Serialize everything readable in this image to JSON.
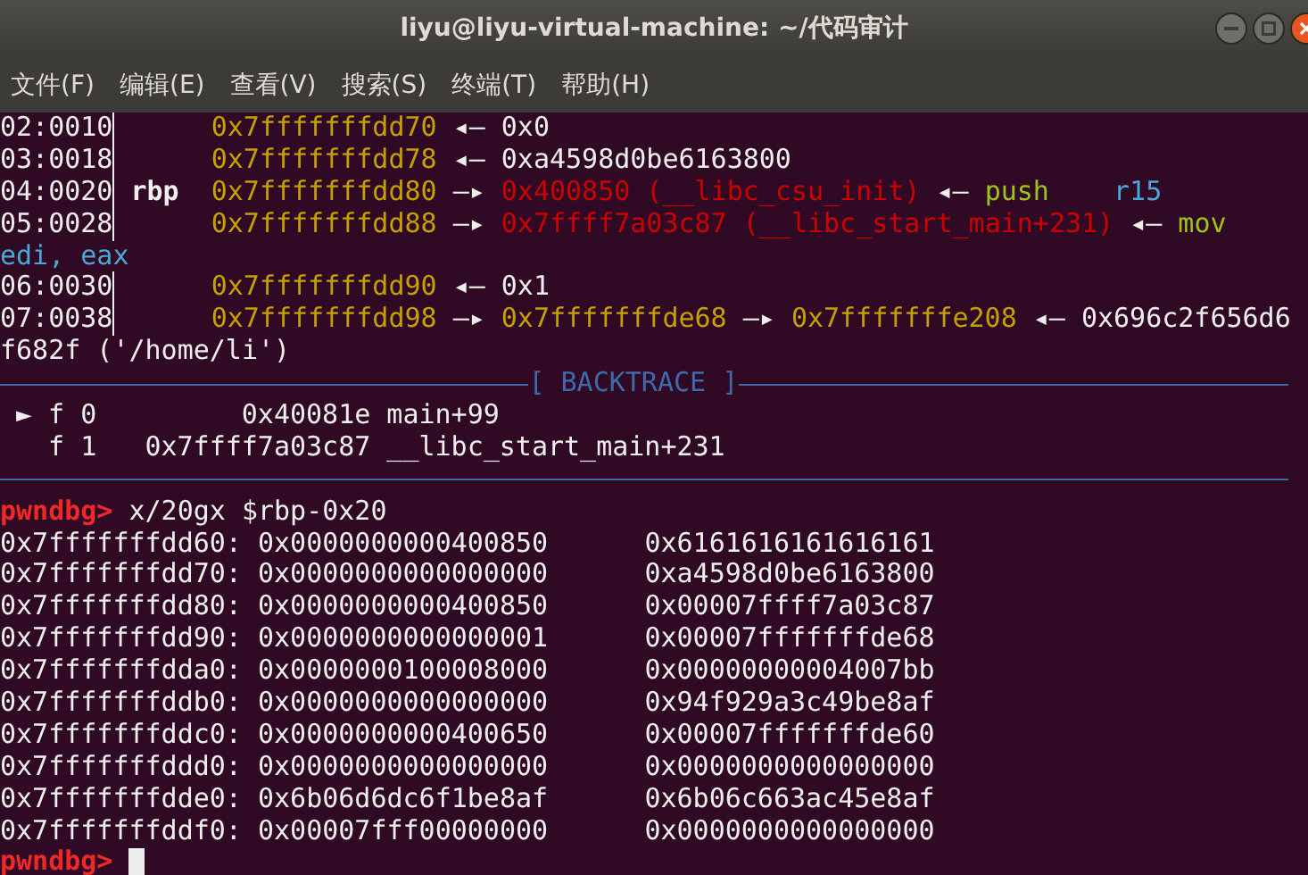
{
  "window": {
    "title": "liyu@liyu-virtual-machine: ~/代码审计"
  },
  "menu": [
    "文件(F)",
    "编辑(E)",
    "查看(V)",
    "搜索(S)",
    "终端(T)",
    "帮助(H)"
  ],
  "terminal": {
    "lines": [
      {
        "kind": "stack",
        "offset": "02:0010",
        "chain": [
          {
            "kind": "address",
            "text": "0x7fffffffdd70"
          },
          {
            "kind": "arrow",
            "text": "◂—"
          },
          {
            "kind": "value",
            "text": "0x0"
          }
        ]
      },
      {
        "kind": "stack",
        "offset": "03:0018",
        "chain": [
          {
            "kind": "address",
            "text": "0x7fffffffdd78"
          },
          {
            "kind": "arrow",
            "text": "◂—"
          },
          {
            "kind": "value",
            "text": "0xa4598d0be6163800"
          }
        ]
      },
      {
        "kind": "stack",
        "offset": "04:0020",
        "register": "rbp",
        "chain": [
          {
            "kind": "address",
            "text": "0x7fffffffdd80"
          },
          {
            "kind": "arrow",
            "text": "—▸"
          },
          {
            "kind": "code",
            "text": "0x400850 (__libc_csu_init)"
          },
          {
            "kind": "arrow",
            "text": "◂—"
          },
          {
            "kind": "instr",
            "text": "push"
          },
          {
            "kind": "operand",
            "text": "r15"
          }
        ]
      },
      {
        "kind": "stack",
        "offset": "05:0028",
        "chain": [
          {
            "kind": "address",
            "text": "0x7fffffffdd88"
          },
          {
            "kind": "arrow",
            "text": "—▸"
          },
          {
            "kind": "code",
            "text": "0x7ffff7a03c87 (__libc_start_main+231)"
          },
          {
            "kind": "arrow",
            "text": "◂—"
          },
          {
            "kind": "instr",
            "text": "mov"
          }
        ]
      },
      {
        "kind": "wrap",
        "chain": [
          {
            "kind": "operand",
            "text": "edi, eax"
          }
        ]
      },
      {
        "kind": "stack",
        "offset": "06:0030",
        "chain": [
          {
            "kind": "address",
            "text": "0x7fffffffdd90"
          },
          {
            "kind": "arrow",
            "text": "◂—"
          },
          {
            "kind": "value",
            "text": "0x1"
          }
        ]
      },
      {
        "kind": "stack",
        "offset": "07:0038",
        "chain": [
          {
            "kind": "address",
            "text": "0x7fffffffdd98"
          },
          {
            "kind": "arrow",
            "text": "—▸"
          },
          {
            "kind": "address",
            "text": "0x7fffffffde68"
          },
          {
            "kind": "arrow",
            "text": "—▸"
          },
          {
            "kind": "address",
            "text": "0x7fffffffe208"
          },
          {
            "kind": "arrow",
            "text": "◂—"
          },
          {
            "kind": "value",
            "text": "0x696c2f656d6"
          }
        ]
      },
      {
        "kind": "wrap",
        "chain": [
          {
            "kind": "value",
            "text": "f682f ('/home/li')"
          }
        ]
      },
      {
        "kind": "section",
        "label": "[ BACKTRACE ]"
      },
      {
        "kind": "frame",
        "marker": "►",
        "index": "f 0",
        "address": "0x40081e",
        "symbol": "main+99"
      },
      {
        "kind": "frame",
        "index": "f 1",
        "address": "0x7ffff7a03c87",
        "symbol": "__libc_start_main+231"
      },
      {
        "kind": "rule"
      },
      {
        "kind": "prompt",
        "prompt": "pwndbg>",
        "command": "x/20gx $rbp-0x20"
      },
      {
        "kind": "memory",
        "address": "0x7fffffffdd60:",
        "values": [
          "0x0000000000400850",
          "0x6161616161616161"
        ]
      },
      {
        "kind": "memory",
        "address": "0x7fffffffdd70:",
        "values": [
          "0x0000000000000000",
          "0xa4598d0be6163800"
        ]
      },
      {
        "kind": "memory",
        "address": "0x7fffffffdd80:",
        "values": [
          "0x0000000000400850",
          "0x00007ffff7a03c87"
        ]
      },
      {
        "kind": "memory",
        "address": "0x7fffffffdd90:",
        "values": [
          "0x0000000000000001",
          "0x00007fffffffde68"
        ]
      },
      {
        "kind": "memory",
        "address": "0x7fffffffdda0:",
        "values": [
          "0x0000000100008000",
          "0x00000000004007bb"
        ]
      },
      {
        "kind": "memory",
        "address": "0x7fffffffddb0:",
        "values": [
          "0x0000000000000000",
          "0x94f929a3c49be8af"
        ]
      },
      {
        "kind": "memory",
        "address": "0x7fffffffddc0:",
        "values": [
          "0x0000000000400650",
          "0x00007fffffffde60"
        ]
      },
      {
        "kind": "memory",
        "address": "0x7fffffffddd0:",
        "values": [
          "0x0000000000000000",
          "0x0000000000000000"
        ]
      },
      {
        "kind": "memory",
        "address": "0x7fffffffdde0:",
        "values": [
          "0x6b06d6dc6f1be8af",
          "0x6b06c663ac45e8af"
        ]
      },
      {
        "kind": "memory",
        "address": "0x7fffffffddf0:",
        "values": [
          "0x00007fff00000000",
          "0x0000000000000000"
        ]
      },
      {
        "kind": "prompt",
        "prompt": "pwndbg>",
        "cursor": true
      }
    ]
  }
}
